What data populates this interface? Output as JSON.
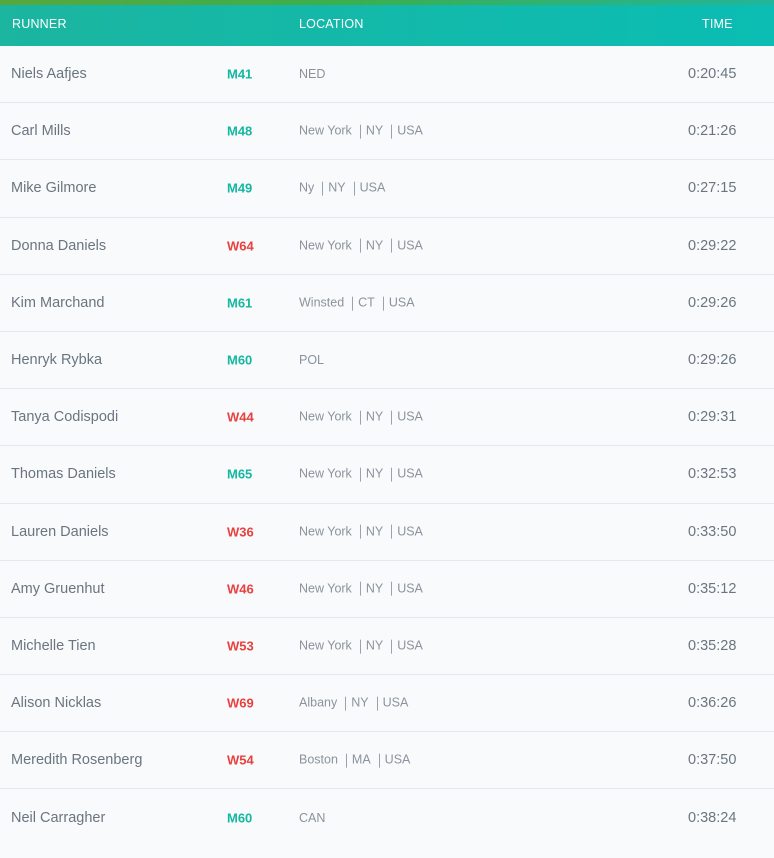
{
  "header": {
    "runner_label": "RUNNER",
    "location_label": "LOCATION",
    "time_label": "TIME"
  },
  "colors": {
    "men": "#14b8a0",
    "women": "#e8413f",
    "header_bg": "#0bbdb3"
  },
  "results": [
    {
      "name": "Niels Aafjes",
      "category": "M41",
      "gender": "men",
      "location": [
        "NED"
      ],
      "time": "0:20:45"
    },
    {
      "name": "Carl Mills",
      "category": "M48",
      "gender": "men",
      "location": [
        "New York",
        "NY",
        "USA"
      ],
      "time": "0:21:26"
    },
    {
      "name": "Mike Gilmore",
      "category": "M49",
      "gender": "men",
      "location": [
        "Ny",
        "NY",
        "USA"
      ],
      "time": "0:27:15"
    },
    {
      "name": "Donna Daniels",
      "category": "W64",
      "gender": "women",
      "location": [
        "New York",
        "NY",
        "USA"
      ],
      "time": "0:29:22"
    },
    {
      "name": "Kim Marchand",
      "category": "M61",
      "gender": "men",
      "location": [
        "Winsted",
        "CT",
        "USA"
      ],
      "time": "0:29:26"
    },
    {
      "name": "Henryk Rybka",
      "category": "M60",
      "gender": "men",
      "location": [
        "POL"
      ],
      "time": "0:29:26"
    },
    {
      "name": "Tanya Codispodi",
      "category": "W44",
      "gender": "women",
      "location": [
        "New York",
        "NY",
        "USA"
      ],
      "time": "0:29:31"
    },
    {
      "name": "Thomas Daniels",
      "category": "M65",
      "gender": "men",
      "location": [
        "New York",
        "NY",
        "USA"
      ],
      "time": "0:32:53"
    },
    {
      "name": "Lauren Daniels",
      "category": "W36",
      "gender": "women",
      "location": [
        "New York",
        "NY",
        "USA"
      ],
      "time": "0:33:50"
    },
    {
      "name": "Amy Gruenhut",
      "category": "W46",
      "gender": "women",
      "location": [
        "New York",
        "NY",
        "USA"
      ],
      "time": "0:35:12"
    },
    {
      "name": "Michelle Tien",
      "category": "W53",
      "gender": "women",
      "location": [
        "New York",
        "NY",
        "USA"
      ],
      "time": "0:35:28"
    },
    {
      "name": "Alison Nicklas",
      "category": "W69",
      "gender": "women",
      "location": [
        "Albany",
        "NY",
        "USA"
      ],
      "time": "0:36:26"
    },
    {
      "name": "Meredith Rosenberg",
      "category": "W54",
      "gender": "women",
      "location": [
        "Boston",
        "MA",
        "USA"
      ],
      "time": "0:37:50"
    },
    {
      "name": "Neil Carragher",
      "category": "M60",
      "gender": "men",
      "location": [
        "CAN"
      ],
      "time": "0:38:24"
    }
  ]
}
